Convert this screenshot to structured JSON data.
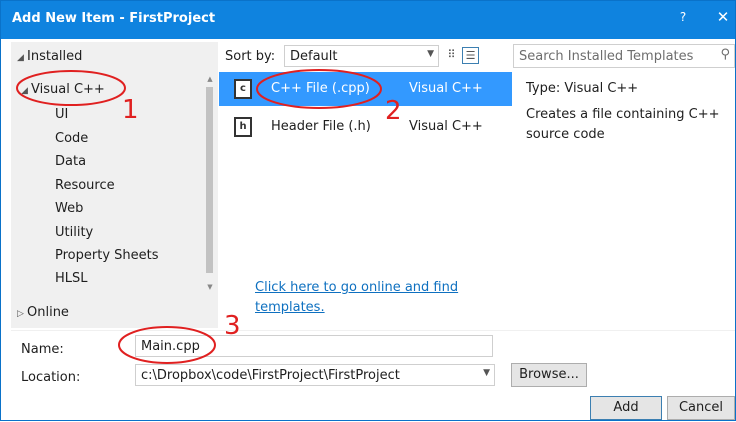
{
  "window": {
    "title": "Add New Item - FirstProject",
    "help_label": "?",
    "close_label": "✕"
  },
  "tree": {
    "installed_label": "Installed",
    "visual_cpp_label": "Visual C++",
    "children": [
      "UI",
      "Code",
      "Data",
      "Resource",
      "Web",
      "Utility",
      "Property Sheets",
      "HLSL"
    ],
    "online_label": "Online"
  },
  "toolbar": {
    "sort_label": "Sort by:",
    "sort_value": "Default",
    "search_placeholder": "Search Installed Templates"
  },
  "templates": [
    {
      "name": "C++ File (.cpp)",
      "type": "Visual C++",
      "icon": "cpp-file-icon",
      "selected": true
    },
    {
      "name": "Header File (.h)",
      "type": "Visual C++",
      "icon": "header-file-icon",
      "selected": false
    }
  ],
  "online_link": {
    "line1": "Click here to go online and find",
    "line2": "templates."
  },
  "info": {
    "type_text": "Type:  Visual C++",
    "description_line1": "Creates a file containing C++",
    "description_line2": "source code"
  },
  "form": {
    "name_label": "Name:",
    "name_value": "Main.cpp",
    "location_label": "Location:",
    "location_value": "c:\\Dropbox\\code\\FirstProject\\FirstProject",
    "browse_label": "Browse...",
    "add_label": "Add",
    "cancel_label": "Cancel"
  },
  "annotations": [
    "1",
    "2",
    "3"
  ],
  "colors": {
    "title_bar": "#0f83df",
    "selection": "#3399ff",
    "annotation": "#e02020",
    "link": "#0e70c0"
  }
}
